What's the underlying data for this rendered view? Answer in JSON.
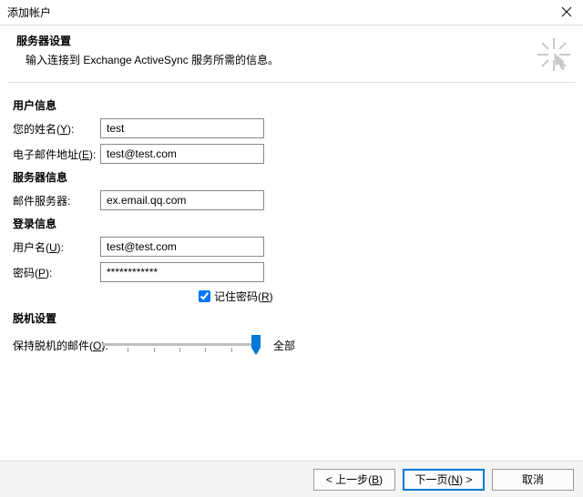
{
  "window": {
    "title": "添加帐户"
  },
  "header": {
    "heading": "服务器设置",
    "subtext": "输入连接到 Exchange ActiveSync 服务所需的信息。"
  },
  "sections": {
    "user_info": "用户信息",
    "server_info": "服务器信息",
    "login_info": "登录信息",
    "offline": "脱机设置"
  },
  "labels": {
    "your_name_pre": "您的姓名(",
    "your_name_u": "Y",
    "your_name_post": "):",
    "email_pre": "电子邮件地址(",
    "email_u": "E",
    "email_post": "):",
    "mail_server": "邮件服务器:",
    "username_pre": "用户名(",
    "username_u": "U",
    "username_post": "):",
    "password_pre": "密码(",
    "password_u": "P",
    "password_post": "):",
    "remember_pre": "记住密码(",
    "remember_u": "R",
    "remember_post": ")",
    "offline_pre": "保持脱机的邮件(",
    "offline_u": "O",
    "offline_post": "):"
  },
  "values": {
    "your_name": "test",
    "email": "test@test.com",
    "mail_server": "ex.email.qq.com",
    "username": "test@test.com",
    "password": "************",
    "remember_checked": true,
    "slider_value": "全部"
  },
  "buttons": {
    "back_pre": "< 上一步(",
    "back_u": "B",
    "back_post": ")",
    "next_pre": "下一页(",
    "next_u": "N",
    "next_post": ") >",
    "cancel": "取消"
  }
}
